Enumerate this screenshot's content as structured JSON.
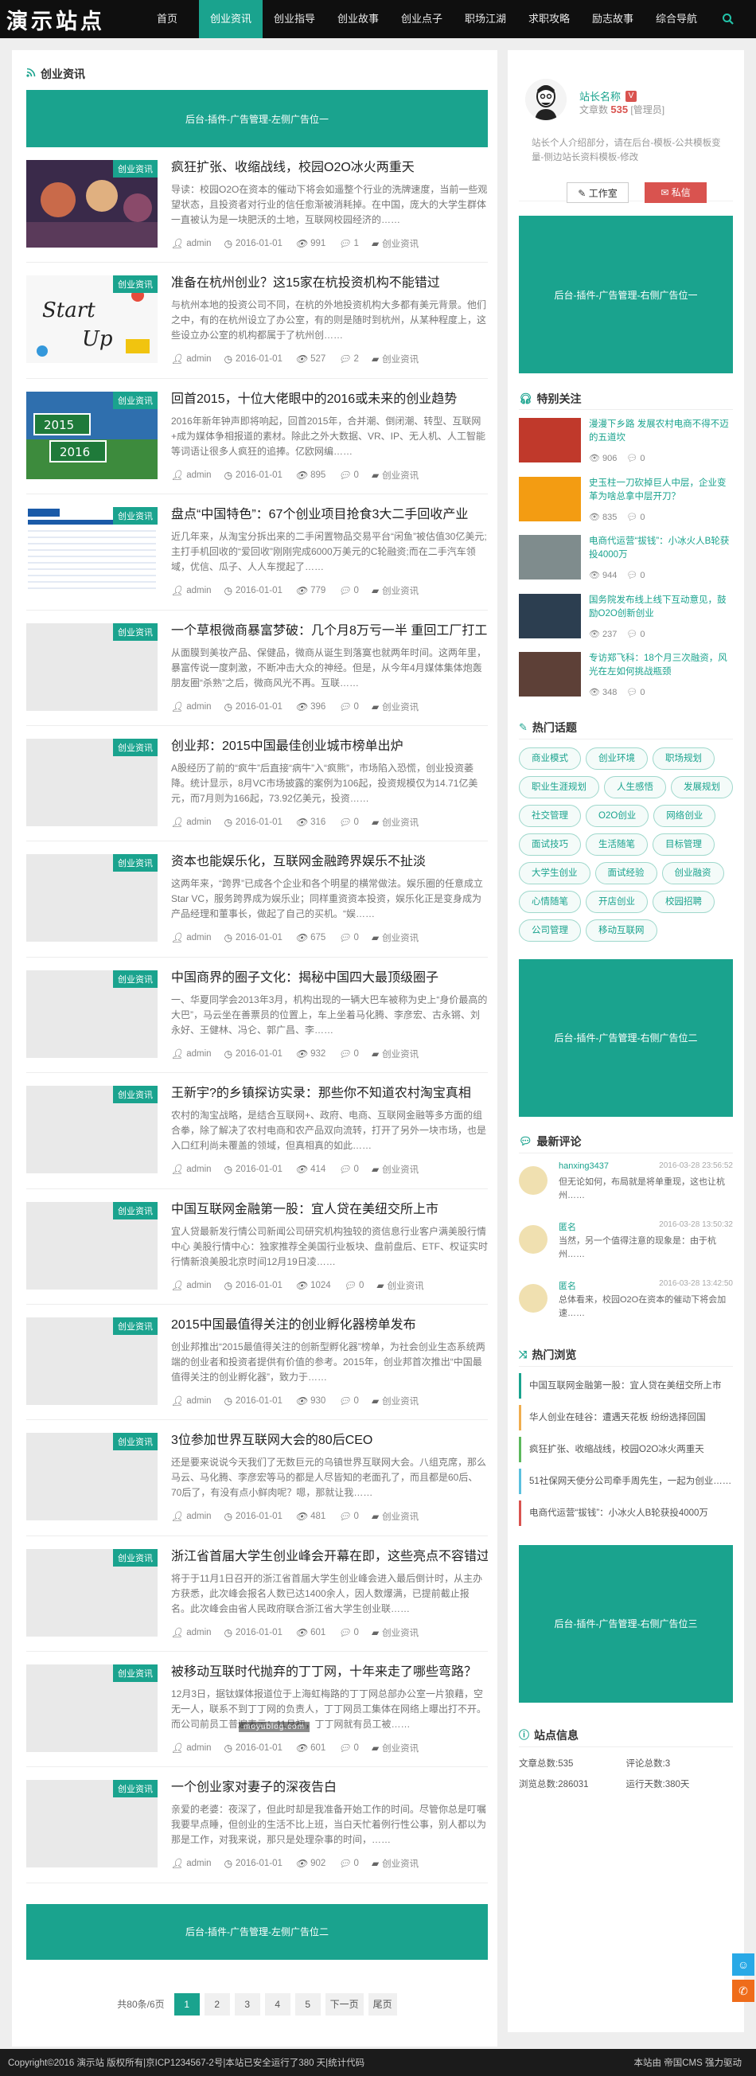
{
  "header": {
    "logo": "演示站点",
    "nav": [
      "首页",
      "创业资讯",
      "创业指导",
      "创业故事",
      "创业点子",
      "职场江湖",
      "求职攻略",
      "励志故事",
      "综合导航"
    ],
    "active_index": 1,
    "search_icon": "search-icon"
  },
  "main": {
    "section_title": "创业资讯",
    "ad_top": "后台-插件-广告管理-左侧广告位一",
    "ad_bottom": "后台-插件-广告管理-左侧广告位二",
    "posts": [
      {
        "tag": "创业资讯",
        "title": "疯狂扩张、收缩战线，校园O2O冰火两重天",
        "excerpt": "导读：校园O2O在资本的催动下将会如遥整个行业的洗牌速度，当前一些观望状态，且投资者对行业的信任愈渐被消耗掉。在中国，庞大的大学生群体一直被认为是一块肥沃的土地，互联网校园经济的……",
        "author": "admin",
        "date": "2016-01-01",
        "views": "991",
        "comments": "1",
        "category": "创业资讯"
      },
      {
        "tag": "创业资讯",
        "title": "准备在杭州创业？这15家在杭投资机构不能错过",
        "excerpt": "与杭州本地的投资公司不同，在杭的外地投资机构大多都有美元背景。他们之中，有的在杭州设立了办公室，有的则是随时到杭州，从某种程度上，这些设立办公室的机构都属于了杭州创……",
        "author": "admin",
        "date": "2016-01-01",
        "views": "527",
        "comments": "2",
        "category": "创业资讯"
      },
      {
        "tag": "创业资讯",
        "title": "回首2015，十位大佬眼中的2016或未来的创业趋势",
        "excerpt": "2016年新年钟声即将响起，回首2015年，合并潮、倒闭潮、转型、互联网+成为媒体争相报道的素材。除此之外大数据、VR、IP、无人机、人工智能等词语让很多人疯狂的追捧。亿欧网编……",
        "author": "admin",
        "date": "2016-01-01",
        "views": "895",
        "comments": "0",
        "category": "创业资讯"
      },
      {
        "tag": "创业资讯",
        "title": "盘点“中国特色”：67个创业项目抢食3大二手回收产业",
        "excerpt": "近几年来，从淘宝分拆出来的二手闲置物品交易平台“闲鱼”被估值30亿美元;主打手机回收的“爱回收”刚刚完成6000万美元的C轮融资;而在二手汽车领域，优信、瓜子、人人车搅起了……",
        "author": "admin",
        "date": "2016-01-01",
        "views": "779",
        "comments": "0",
        "category": "创业资讯"
      },
      {
        "tag": "创业资讯",
        "title": "一个草根微商暴富梦破：几个月8万亏一半 重回工厂打工",
        "excerpt": "从面膜到美妆产品、保健品，微商从诞生到落寞也就两年时间。这两年里，暴富传说一度刺激，不断冲击大众的神经。但是，从今年4月媒体集体炮轰朋友圈“杀熟”之后，微商风光不再。互联……",
        "author": "admin",
        "date": "2016-01-01",
        "views": "396",
        "comments": "0",
        "category": "创业资讯"
      },
      {
        "tag": "创业资讯",
        "title": "创业邦：2015中国最佳创业城市榜单出炉",
        "excerpt": "A股经历了前的“疯牛”后直接“病牛”入“疯熊”，市场陷入恐慌，创业投资萎降。统计显示，8月VC市场披露的案例为106起，投资规模仅为14.71亿美元，而7月则为166起，73.92亿美元，投资……",
        "author": "admin",
        "date": "2016-01-01",
        "views": "316",
        "comments": "0",
        "category": "创业资讯"
      },
      {
        "tag": "创业资讯",
        "title": "资本也能娱乐化，互联网金融跨界娱乐不扯淡",
        "excerpt": "这两年来，“跨界”已成各个企业和各个明星的横常做法。娱乐圈的任意成立Star VC，服务跨界成为娱乐业；同样重资资本投资，娱乐化正是变身成为产品经理和董事长，做起了自己的买机。“娱……",
        "author": "admin",
        "date": "2016-01-01",
        "views": "675",
        "comments": "0",
        "category": "创业资讯"
      },
      {
        "tag": "创业资讯",
        "title": "中国商界的圈子文化：揭秘中国四大最顶级圈子",
        "excerpt": "一、华夏同学会2013年3月，机构出现的一辆大巴车被称为史上“身价最高的大巴”，马云坐在善票员的位置上，车上坐着马化腾、李彦宏、古永锵、刘永好、王健林、冯仑、郭广昌、李……",
        "author": "admin",
        "date": "2016-01-01",
        "views": "932",
        "comments": "0",
        "category": "创业资讯"
      },
      {
        "tag": "创业资讯",
        "title": "王新宇?的乡镇探访实录：那些你不知道农村淘宝真相",
        "excerpt": "农村的淘宝战略，是结合互联网+、政府、电商、互联网金融等多方面的组合拳，除了解决了农村电商和农产品双向流转，打开了另外一块市场，也是入口红利尚未覆盖的领域，但真相真的如此……",
        "author": "admin",
        "date": "2016-01-01",
        "views": "414",
        "comments": "0",
        "category": "创业资讯"
      },
      {
        "tag": "创业资讯",
        "title": "中国互联网金融第一股：宜人贷在美纽交所上市",
        "excerpt": "宜人贷最新发行情公司新闻公司研究机构独较的资信息行业客户满美股行情中心 美股行情中心：独家推荐全美国行业板块、盘前盘后、ETF、权证实时行情新浪美股北京时间12月19日凌……",
        "author": "admin",
        "date": "2016-01-01",
        "views": "1024",
        "comments": "0",
        "category": "创业资讯"
      },
      {
        "tag": "创业资讯",
        "title": "2015中国最值得关注的创业孵化器榜单发布",
        "excerpt": "创业邦推出“2015最值得关注的创新型孵化器”榜单，为社会创业生态系统两端的创业者和投资者提供有价值的参考。2015年，创业邦首次推出“中国最值得关注的创业孵化器”，致力于……",
        "author": "admin",
        "date": "2016-01-01",
        "views": "930",
        "comments": "0",
        "category": "创业资讯"
      },
      {
        "tag": "创业资讯",
        "title": "3位参加世界互联网大会的80后CEO",
        "excerpt": "还是要来说说今天我们了无数巨元的乌镇世界互联网大会。八组克席，那么马云、马化腾、李彦宏等马的都是人尽皆知的老面孔了，而且都是60后、70后了，有没有点小鲜肉呢？嗯，那就让我……",
        "author": "admin",
        "date": "2016-01-01",
        "views": "481",
        "comments": "0",
        "category": "创业资讯"
      },
      {
        "tag": "创业资讯",
        "title": "浙江省首届大学生创业峰会开幕在即，这些亮点不容错过",
        "excerpt": "将于于11月1日召开的浙江省首届大学生创业峰会进入最后倒计时，从主办方获悉，此次峰会报名人数已达1400余人，因人数爆满，已提前截止报名。此次峰会由省人民政府联合浙江省大学生创业联……",
        "author": "admin",
        "date": "2016-01-01",
        "views": "601",
        "comments": "0",
        "category": "创业资讯"
      },
      {
        "tag": "创业资讯",
        "title": "被移动互联时代抛弃的丁丁网，十年来走了哪些弯路？",
        "excerpt": "12月3日，据钛媒体报道位于上海虹梅路的丁丁网总部办公室一片狼藉，空无一人，联系不到丁丁网的负责人，丁丁网员工集体在网络上曝出打不开。而公司前员工普遍表示：11月初，丁丁网就有员工被……",
        "author": "admin",
        "date": "2016-01-01",
        "views": "601",
        "comments": "0",
        "category": "创业资讯"
      },
      {
        "tag": "创业资讯",
        "title": "一个创业家对妻子的深夜告白",
        "excerpt": "亲爱的老婆：夜深了，但此时却是我准备开始工作的时间。尽管你总是叮嘱我要早点睡，但创业的生活不比上班，当白天忙着例行性公事，别人都以为那是工作，对我来说，那只是处理杂事的时间，……",
        "author": "admin",
        "date": "2016-01-01",
        "views": "902",
        "comments": "0",
        "category": "创业资讯"
      }
    ],
    "pager": {
      "info": "共80条/6页",
      "pages": [
        "1",
        "2",
        "3",
        "4",
        "5"
      ],
      "current": "1",
      "next": "下一页",
      "last": "尾页"
    }
  },
  "sidebar": {
    "profile": {
      "name": "站长名称",
      "badge": "V",
      "stat_label": "文章数",
      "stat_value": "535",
      "role": "[管理员]",
      "desc": "站长个人介绍部分，请在后台-模板-公共模板变量-侧边站长资料模板-修改",
      "work_btn": "工作室",
      "msg_btn": "私信"
    },
    "ad1": "后台-插件-广告管理-右侧广告位一",
    "ad2": "后台-插件-广告管理-右侧广告位二",
    "ad3": "后台-插件-广告管理-右侧广告位三",
    "featured_title": "特别关注",
    "featured": [
      {
        "title": "漫漫下乡路 发展农村电商不得不迈的五道坎",
        "views": "906",
        "comments": "0"
      },
      {
        "title": "史玉柱一刀砍掉巨人中层，企业变革为啥总拿中层开刀？",
        "views": "835",
        "comments": "0"
      },
      {
        "title": "电商代运营“拔钱”：小冰火人B轮获投4000万",
        "views": "944",
        "comments": "0"
      },
      {
        "title": "国务院发布线上线下互动意见，鼓励O2O创新创业",
        "views": "237",
        "comments": "0"
      },
      {
        "title": "专访郑飞科：18个月三次融资，风光在左如何挑战瓶颈",
        "views": "348",
        "comments": "0"
      }
    ],
    "tags_title": "热门话题",
    "tags": [
      "商业模式",
      "创业环境",
      "职场规划",
      "职业生涯规划",
      "人生感悟",
      "发展规划",
      "社交管理",
      "O2O创业",
      "网络创业",
      "面试技巧",
      "生活随笔",
      "目标管理",
      "大学生创业",
      "面试经验",
      "创业融资",
      "心情随笔",
      "开店创业",
      "校园招聘",
      "公司管理",
      "移动互联网"
    ],
    "comments_title": "最新评论",
    "comments": [
      {
        "name": "hanxing3437",
        "time": "2016-03-28 23:56:52",
        "text": "但无论如何，布局就是将单重现，这也让杭州……"
      },
      {
        "name": "匿名",
        "time": "2016-03-28 13:50:32",
        "text": "当然，另一个值得注意的现象是：由于杭州……"
      },
      {
        "name": "匿名",
        "time": "2016-03-28 13:42:50",
        "text": "总体看来，校园O2O在资本的催动下将会加速……"
      }
    ],
    "hotview_title": "热门浏览",
    "hotview": [
      "中国互联网金融第一股：宜人贷在美纽交所上市",
      "华人创业在硅谷：遭遇天花板 纷纷选择回国",
      "疯狂扩张、收缩战线，校园O2O冰火两重天",
      "51社保网天使分公司牵手周先生，一起为创业……",
      "电商代运营“拔钱”：小冰火人B轮获投4000万"
    ],
    "stats_title": "站点信息",
    "stats": [
      "文章总数:535",
      "评论总数:3",
      "浏览总数:286031",
      "运行天数:380天"
    ]
  },
  "watermark": "moyublog.com",
  "footer": {
    "left": "Copyright©2016 演示站 版权所有|京ICP1234567-2号|本站已安全运行了380 天|统计代码",
    "right": "本站由 帝国CMS 强力驱动"
  },
  "colors": {
    "accent": "#1aa38e",
    "danger": "#d9534f",
    "header_bg": "#0f0f0f"
  }
}
